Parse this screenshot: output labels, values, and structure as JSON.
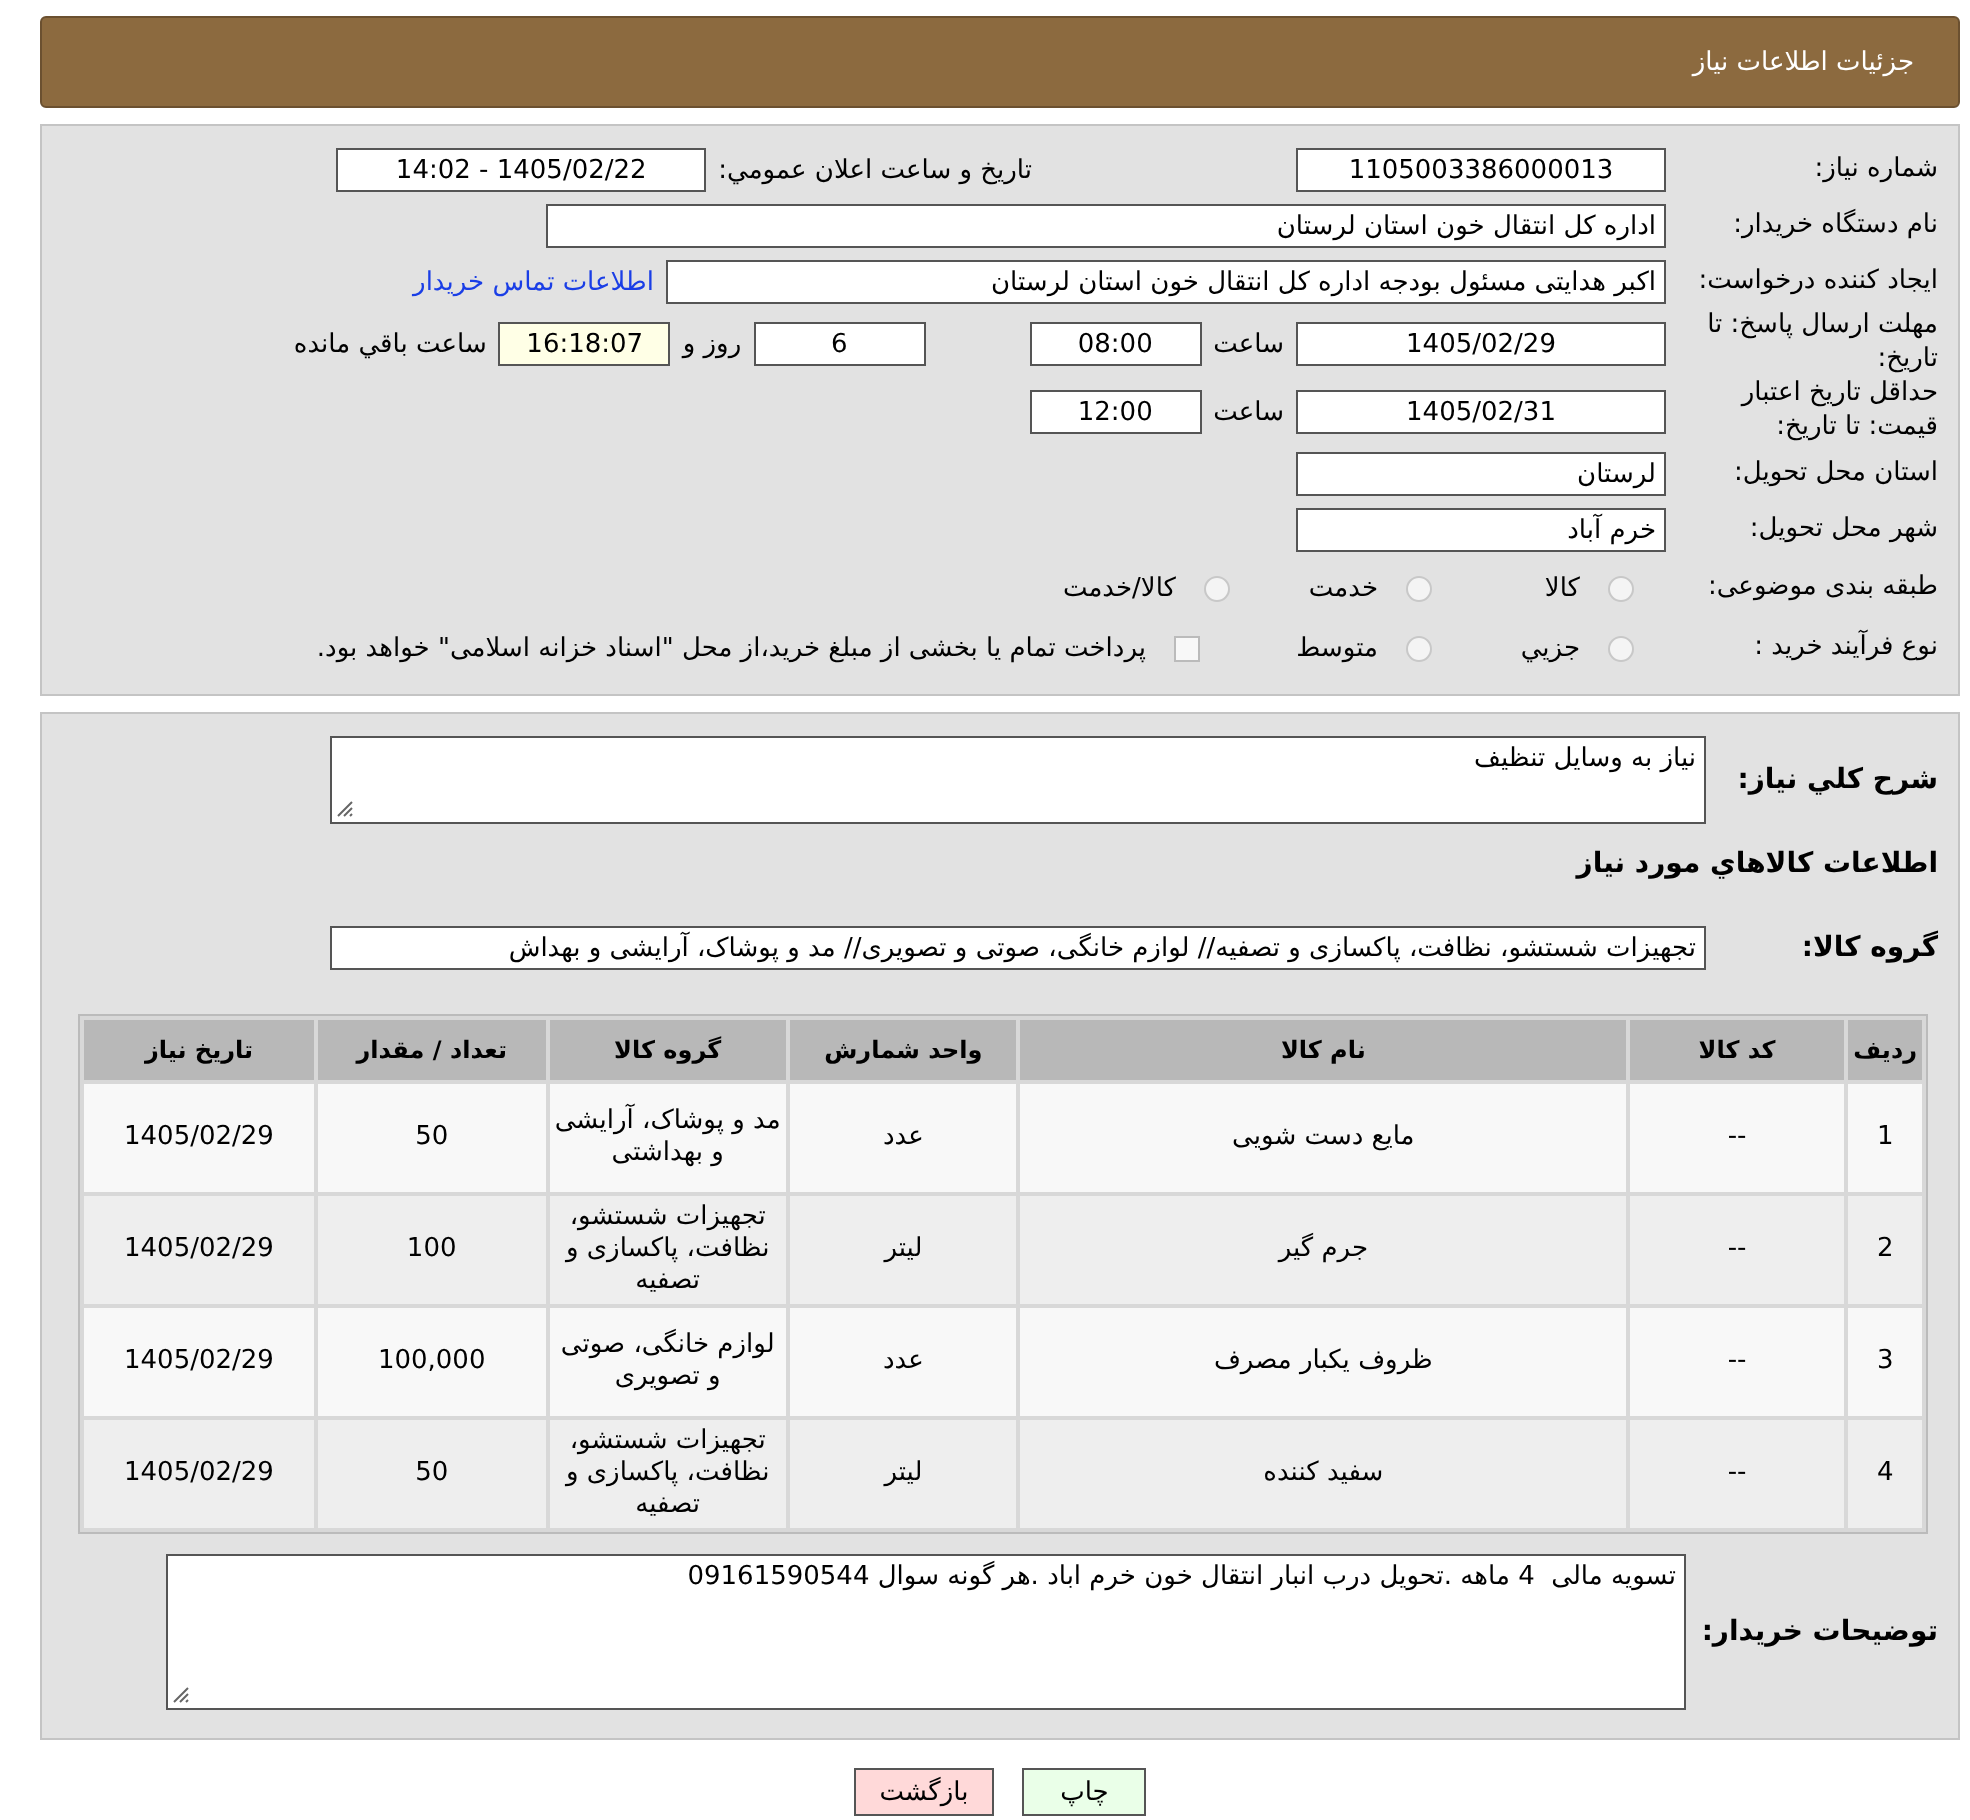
{
  "header": {
    "title": "جزئیات اطلاعات نیاز"
  },
  "need_number": {
    "label": "شماره نیاز:",
    "value": "1105003386000013"
  },
  "announce": {
    "label": "تاریخ و ساعت اعلان عمومي:",
    "value": "1405/02/22 - 14:02"
  },
  "buyer": {
    "label": "نام دستگاه خریدار:",
    "value": "اداره کل انتقال خون استان لرستان"
  },
  "requester": {
    "label": "ایجاد کننده درخواست:",
    "value": "اکبر هدایتی مسئول بودجه اداره کل انتقال خون استان لرستان",
    "link": "اطلاعات تماس خریدار"
  },
  "reply_deadline": {
    "label": "مهلت ارسال پاسخ: تا تاریخ:",
    "date": "1405/02/29",
    "time_label": "ساعت",
    "time": "08:00",
    "days": "6",
    "days_label": "روز و",
    "remaining": "16:18:07",
    "remaining_label": "ساعت باقي مانده"
  },
  "price_validity": {
    "label": "حداقل تاریخ اعتبار قیمت: تا تاریخ:",
    "date": "1405/02/31",
    "time_label": "ساعت",
    "time": "12:00"
  },
  "province": {
    "label": "استان محل تحویل:",
    "value": "لرستان"
  },
  "city": {
    "label": "شهر محل تحویل:",
    "value": "خرم آباد"
  },
  "category": {
    "label": "طبقه بندی موضوعی:",
    "options": [
      {
        "label": "کالا",
        "selected": false
      },
      {
        "label": "خدمت",
        "selected": false
      },
      {
        "label": "کالا/خدمت",
        "selected": false
      }
    ]
  },
  "purchase_type": {
    "label": "نوع فرآیند خرید :",
    "options": [
      {
        "label": "جزيي",
        "selected": false
      },
      {
        "label": "متوسط",
        "selected": false
      }
    ],
    "payment_note": {
      "label": "پرداخت تمام یا بخشی از مبلغ خرید،از محل \"اسناد خزانه اسلامی\" خواهد بود.",
      "checked": false
    }
  },
  "description": {
    "label": "شرح کلي نیاز:",
    "value": "نیاز به وسایل تنظیف"
  },
  "goods_title": "اطلاعات کالاهاي مورد نیاز",
  "goods_group": {
    "label": "گروه کالا:",
    "value": "تجهیزات شستشو، نظافت، پاکسازی و تصفیه// لوازم خانگی، صوتی و تصویری// مد و پوشاک، آرایشی و بهداش"
  },
  "table": {
    "columns": [
      "ردیف",
      "کد کالا",
      "نام کالا",
      "واحد شمارش",
      "گروه کالا",
      "تعداد / مقدار",
      "تاریخ نیاز"
    ],
    "rows": [
      [
        "1",
        "--",
        "مایع دست شویی",
        "عدد",
        "مد و پوشاک، آرایشی و بهداشتی",
        "50",
        "1405/02/29"
      ],
      [
        "2",
        "--",
        "جرم گیر",
        "لیتر",
        "تجهیزات شستشو، نظافت، پاکسازی و تصفیه",
        "100",
        "1405/02/29"
      ],
      [
        "3",
        "--",
        "ظروف یکبار مصرف",
        "عدد",
        "لوازم خانگی، صوتی و تصویری",
        "100,000",
        "1405/02/29"
      ],
      [
        "4",
        "--",
        "سفید کننده",
        "لیتر",
        "تجهیزات شستشو، نظافت، پاکسازی و تصفیه",
        "50",
        "1405/02/29"
      ]
    ]
  },
  "buyer_notes": {
    "label": "توضیحات خریدار:",
    "value": "تسویه مالی  4 ماهه .تحویل درب انبار انتقال خون خرم اباد .هر گونه سوال 09161590544"
  },
  "buttons": [
    {
      "label": "چاپ",
      "kind": "print"
    },
    {
      "label": "بازگشت",
      "kind": "back"
    }
  ]
}
